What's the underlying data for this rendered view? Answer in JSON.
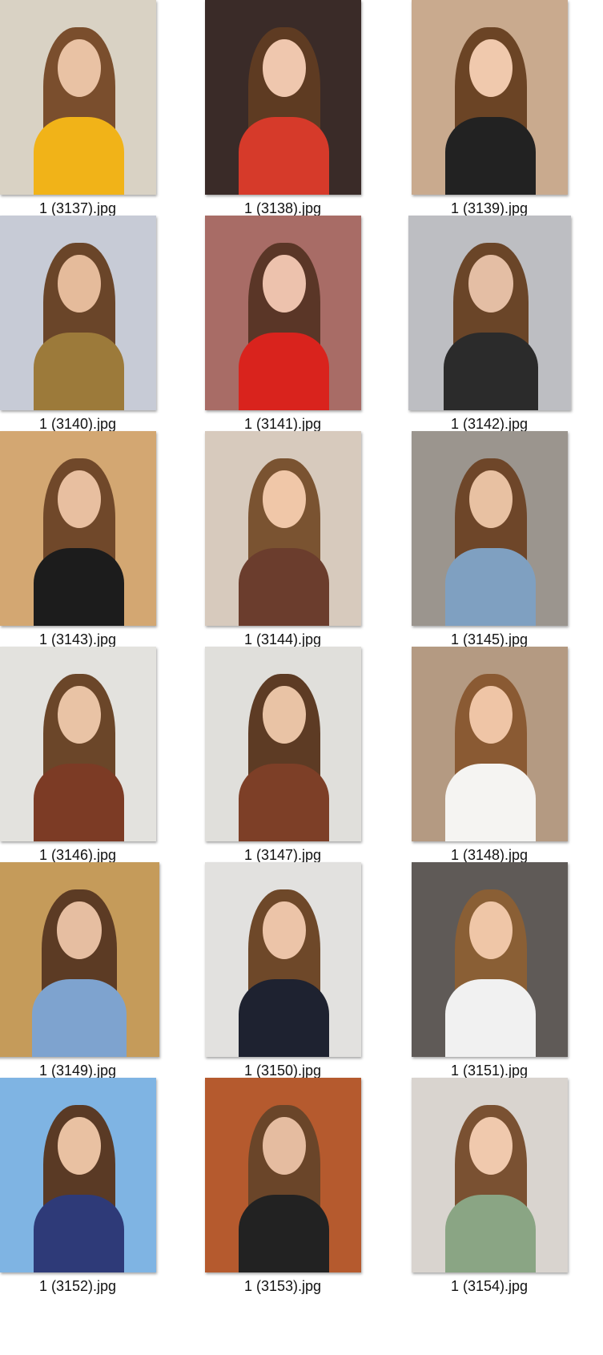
{
  "files": [
    {
      "name": "1 (3137).jpg",
      "bg": "#d9d2c4",
      "accent": "#f1b318",
      "hair": "#7a4e2d",
      "skin": "#e9c2a4",
      "shape": "tall"
    },
    {
      "name": "1 (3138).jpg",
      "bg": "#3a2b28",
      "accent": "#d63a2a",
      "hair": "#5e3b22",
      "skin": "#efc7ae",
      "shape": "tall"
    },
    {
      "name": "1 (3139).jpg",
      "bg": "#c9aa8e",
      "accent": "#222222",
      "hair": "#6b4425",
      "skin": "#f0c9ad",
      "shape": "tall"
    },
    {
      "name": "1 (3140).jpg",
      "bg": "#c7cbd6",
      "accent": "#9c7a3a",
      "hair": "#6a4529",
      "skin": "#e5bb9b",
      "shape": "tall"
    },
    {
      "name": "1 (3141).jpg",
      "bg": "#a86c66",
      "accent": "#d9231d",
      "hair": "#5a3627",
      "skin": "#edc2ad",
      "shape": "tall"
    },
    {
      "name": "1 (3142).jpg",
      "bg": "#bdbec2",
      "accent": "#2b2b2b",
      "hair": "#6a4528",
      "skin": "#e4bea4",
      "shape": "wide"
    },
    {
      "name": "1 (3143).jpg",
      "bg": "#d3a772",
      "accent": "#1c1c1c",
      "hair": "#70482a",
      "skin": "#e8bfa0",
      "shape": "tall"
    },
    {
      "name": "1 (3144).jpg",
      "bg": "#d7cabd",
      "accent": "#6b3d2d",
      "hair": "#7a5331",
      "skin": "#f0c7a8",
      "shape": "tall"
    },
    {
      "name": "1 (3145).jpg",
      "bg": "#9b958e",
      "accent": "#7fa0c1",
      "hair": "#6e4629",
      "skin": "#e8c1a2",
      "shape": "tall"
    },
    {
      "name": "1 (3146).jpg",
      "bg": "#e3e2de",
      "accent": "#7c3b25",
      "hair": "#6b4629",
      "skin": "#e9c3a5",
      "shape": "tall"
    },
    {
      "name": "1 (3147).jpg",
      "bg": "#e0dfdb",
      "accent": "#7d3f27",
      "hair": "#5d3b24",
      "skin": "#e9c3a5",
      "shape": "tall"
    },
    {
      "name": "1 (3148).jpg",
      "bg": "#b49a82",
      "accent": "#f5f4f2",
      "hair": "#8a5a33",
      "skin": "#efc5a6",
      "shape": "tall"
    },
    {
      "name": "1 (3149).jpg",
      "bg": "#c59b5a",
      "accent": "#7ea3cf",
      "hair": "#5c3b24",
      "skin": "#e6bea1",
      "shape": "wide"
    },
    {
      "name": "1 (3150).jpg",
      "bg": "#e2e1df",
      "accent": "#1e2230",
      "hair": "#6e4829",
      "skin": "#ecc4a8",
      "shape": "tall"
    },
    {
      "name": "1 (3151).jpg",
      "bg": "#5f5a57",
      "accent": "#f1f1f1",
      "hair": "#8a5f35",
      "skin": "#efc6a7",
      "shape": "tall"
    },
    {
      "name": "1 (3152).jpg",
      "bg": "#7fb4e3",
      "accent": "#2e3a78",
      "hair": "#5a3a25",
      "skin": "#e9c1a2",
      "shape": "tall"
    },
    {
      "name": "1 (3153).jpg",
      "bg": "#b55a2e",
      "accent": "#222222",
      "hair": "#6a4529",
      "skin": "#e5bca0",
      "shape": "tall"
    },
    {
      "name": "1 (3154).jpg",
      "bg": "#d9d4cf",
      "accent": "#8aa584",
      "hair": "#7a5132",
      "skin": "#f0c9ad",
      "shape": "tall"
    }
  ]
}
